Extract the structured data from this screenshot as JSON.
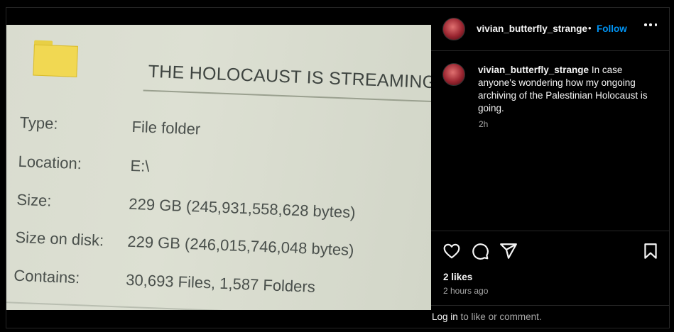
{
  "photo": {
    "folder_name": "THE HOLOCAUST IS STREAMING LIVE",
    "properties": [
      {
        "label": "Type:",
        "value": "File folder"
      },
      {
        "label": "Location:",
        "value": "E:\\"
      },
      {
        "label": "Size:",
        "value": "229 GB (245,931,558,628 bytes)"
      },
      {
        "label": "Size on disk:",
        "value": "229 GB (246,015,746,048 bytes)"
      },
      {
        "label": "Contains:",
        "value": "30,693 Files, 1,587 Folders"
      }
    ]
  },
  "header": {
    "username": "vivian_butterfly_strange",
    "separator": "•",
    "follow_label": "Follow"
  },
  "post": {
    "caption_username": "vivian_butterfly_strange",
    "caption_text": " In case anyone's wondering how my ongoing archiving of the Palestinian Holocaust is going.",
    "caption_time": "2h"
  },
  "engagement": {
    "likes": "2 likes",
    "time_ago": "2 hours ago"
  },
  "footer": {
    "login_link": "Log in",
    "login_rest": " to like or comment."
  },
  "colors": {
    "accent": "#0095f6",
    "background": "#000000",
    "muted": "#a8a8a8"
  },
  "icons": [
    "heart-icon",
    "comment-icon",
    "share-icon",
    "bookmark-icon",
    "more-icon"
  ]
}
